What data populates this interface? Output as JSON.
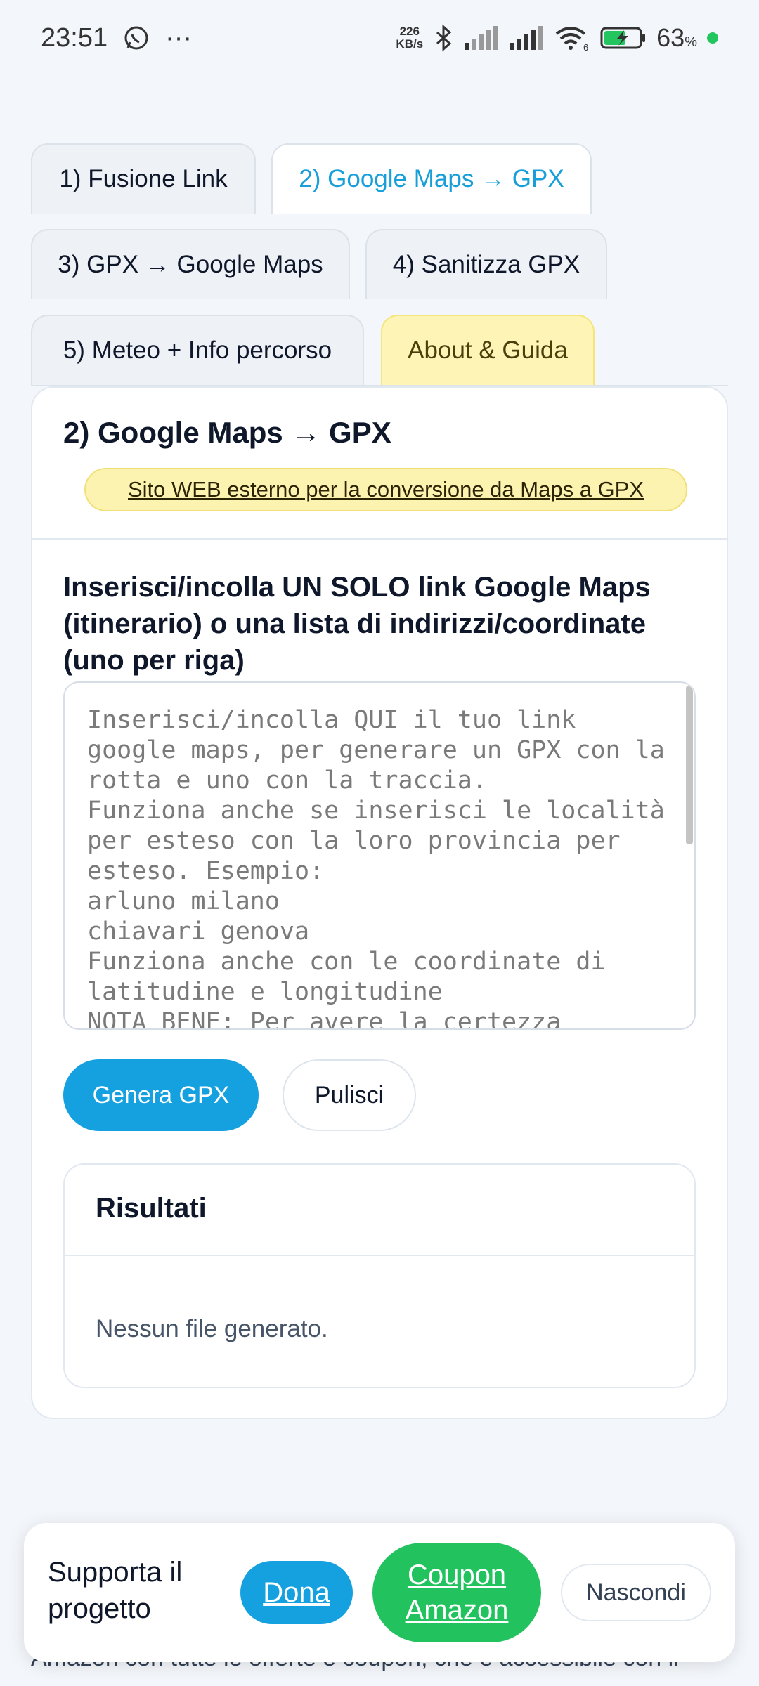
{
  "status_bar": {
    "time": "23:51",
    "more": "···",
    "net_speed_value": "226",
    "net_speed_unit": "KB/s",
    "wifi_badge": "6",
    "battery": "63",
    "battery_unit": "%"
  },
  "tabs": [
    {
      "label": "1) Fusione Link"
    },
    {
      "label": "2) Google Maps → GPX"
    },
    {
      "label": "3) GPX → Google Maps"
    },
    {
      "label": "4) Sanitizza GPX"
    },
    {
      "label": "5) Meteo + Info percorso"
    },
    {
      "label": "About & Guida"
    }
  ],
  "card": {
    "title": "2) Google Maps → GPX",
    "external_link": "Sito WEB esterno per la conversione da Maps a GPX",
    "field_label": "Inserisci/incolla UN SOLO link Google Maps (itinerario) o una lista di indirizzi/coordinate (uno per riga)",
    "textarea_placeholder": "Inserisci/incolla QUI il tuo link google maps, per generare un GPX con la rotta e uno con la traccia.\nFunziona anche se inserisci le località per esteso con la loro provincia per esteso. Esempio:\narluno milano\nchiavari genova\nFunziona anche con le coordinate di latitudine e longitudine\nNOTA BENE: Per avere la certezza",
    "generate_button": "Genera GPX",
    "clear_button": "Pulisci",
    "results_title": "Risultati",
    "results_empty": "Nessun file generato."
  },
  "bottom_text": "Amazon con tutte le offerte e coupon, che è accessibile con il",
  "banner": {
    "text": "Supporta il progetto",
    "donate": "Dona",
    "coupon": "Coupon Amazon",
    "hide": "Nascondi"
  },
  "colors": {
    "accent": "#15a1df",
    "coupon_green": "#22c35e",
    "about_tab": "#fdf4b6"
  }
}
